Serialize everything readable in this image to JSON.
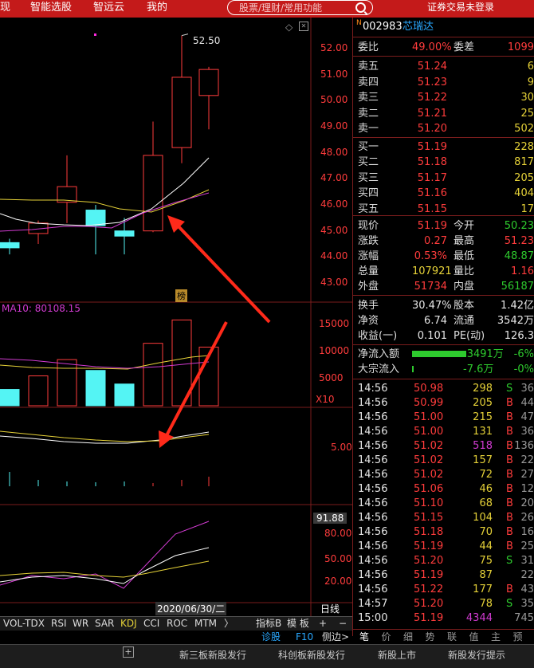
{
  "nav": {
    "items": [
      "现",
      "智能选股",
      "智远云",
      "我的"
    ]
  },
  "search": {
    "placeholder": "股票/理财/常用功能"
  },
  "status": "证券交易未登录",
  "stock": {
    "flag": "N",
    "code": "002983",
    "name": "芯瑞达"
  },
  "chart": {
    "high_mark": "52.50",
    "price_ticks": [
      "52.00",
      "51.00",
      "50.00",
      "49.00",
      "48.00",
      "47.00",
      "46.00",
      "45.00",
      "44.00",
      "43.00"
    ],
    "tag": "榜",
    "vol_label": "MA10: 80108.15",
    "vol_ticks": [
      "15000",
      "10000",
      "5000"
    ],
    "vol_unit": "X10",
    "macd_tick": "5.00",
    "kdj_top": "91.88",
    "kdj_ticks": [
      "80.00",
      "50.00",
      "20.00"
    ],
    "date": "2020/06/30/二",
    "period": "日线",
    "colors": {
      "up": "#ff3c3c",
      "down": "#54f4f4",
      "ma_white": "#ffffff",
      "ma_yellow": "#e6d238",
      "ma_magenta": "#d13bd1"
    }
  },
  "chart_data": {
    "type": "candlestick",
    "candles": [
      {
        "o": 44.55,
        "c": 44.35,
        "h": 44.7,
        "l": 44.1
      },
      {
        "o": 44.9,
        "c": 45.3,
        "h": 45.4,
        "l": 44.5
      },
      {
        "o": 46.1,
        "c": 46.7,
        "h": 47.9,
        "l": 45.3
      },
      {
        "o": 45.8,
        "c": 45.2,
        "h": 46.0,
        "l": 44.1
      },
      {
        "o": 45.0,
        "c": 44.8,
        "h": 45.5,
        "l": 44.1
      },
      {
        "o": 45.0,
        "c": 47.9,
        "h": 49.2,
        "l": 44.95
      },
      {
        "o": 48.2,
        "c": 50.9,
        "h": 52.5,
        "l": 47.6
      },
      {
        "o": 50.2,
        "c": 51.2,
        "h": 51.3,
        "l": 48.9
      }
    ],
    "volume": [
      {
        "v": 3000,
        "up": false
      },
      {
        "v": 5500,
        "up": true
      },
      {
        "v": 8500,
        "up": true
      },
      {
        "v": 6500,
        "up": false
      },
      {
        "v": 4000,
        "up": false
      },
      {
        "v": 11500,
        "up": true
      },
      {
        "v": 15800,
        "up": true
      },
      {
        "v": 10800,
        "up": true
      }
    ],
    "ylim": [
      43,
      52.8
    ]
  },
  "bottom_tabs": [
    "VOL-TDX",
    "RSI",
    "WR",
    "SAR",
    "KDJ",
    "CCI",
    "ROC",
    "MTM"
  ],
  "right_tabs": [
    "指标B",
    "模 板",
    "+",
    "−"
  ],
  "sub_links": [
    "诊股",
    "F10",
    "侧边>"
  ],
  "panel_tabs": [
    "笔",
    "价",
    "细",
    "势",
    "联",
    "值",
    "主",
    "预"
  ],
  "order_book": {
    "head": [
      {
        "label": "委比",
        "value": "49.00%"
      },
      {
        "label": "委差",
        "value": "1099"
      }
    ],
    "asks": [
      {
        "label": "卖五",
        "price": "51.24",
        "vol": "6"
      },
      {
        "label": "卖四",
        "price": "51.23",
        "vol": "9"
      },
      {
        "label": "卖三",
        "price": "51.22",
        "vol": "30"
      },
      {
        "label": "卖二",
        "price": "51.21",
        "vol": "25"
      },
      {
        "label": "卖一",
        "price": "51.20",
        "vol": "502"
      }
    ],
    "bids": [
      {
        "label": "买一",
        "price": "51.19",
        "vol": "228"
      },
      {
        "label": "买二",
        "price": "51.18",
        "vol": "817"
      },
      {
        "label": "买三",
        "price": "51.17",
        "vol": "205"
      },
      {
        "label": "买四",
        "price": "51.16",
        "vol": "404"
      },
      {
        "label": "买五",
        "price": "51.15",
        "vol": "17"
      }
    ]
  },
  "quote": [
    {
      "l1": "现价",
      "v1": "51.19",
      "c1": "red",
      "l2": "今开",
      "v2": "50.23",
      "c2": "grn"
    },
    {
      "l1": "涨跌",
      "v1": "0.27",
      "c1": "red",
      "l2": "最高",
      "v2": "51.23",
      "c2": "red"
    },
    {
      "l1": "涨幅",
      "v1": "0.53%",
      "c1": "red",
      "l2": "最低",
      "v2": "48.87",
      "c2": "grn"
    },
    {
      "l1": "总量",
      "v1": "107921",
      "c1": "yel",
      "l2": "量比",
      "v2": "1.16",
      "c2": "red"
    },
    {
      "l1": "外盘",
      "v1": "51734",
      "c1": "red",
      "l2": "内盘",
      "v2": "56187",
      "c2": "grn"
    }
  ],
  "fund": [
    {
      "l1": "换手",
      "v1": "30.47%",
      "l2": "股本",
      "v2": "1.42亿"
    },
    {
      "l1": "净资",
      "v1": "6.74",
      "l2": "流通",
      "v2": "3542万"
    },
    {
      "l1": "收益(一)",
      "v1": "0.101",
      "l2": "PE(动)",
      "v2": "126.3"
    }
  ],
  "flow": [
    {
      "label": "净流入额",
      "value": "-3491万",
      "pct": "-6%",
      "ratio": 0.85
    },
    {
      "label": "大宗流入",
      "value": "-7.6万",
      "pct": "-0%",
      "ratio": 0.02
    }
  ],
  "ticks": [
    {
      "t": "14:56",
      "p": "50.98",
      "v": "298",
      "s": "S",
      "n": "36",
      "vc": "yel",
      "sc": "grn"
    },
    {
      "t": "14:56",
      "p": "50.99",
      "v": "205",
      "s": "B",
      "n": "44",
      "vc": "yel",
      "sc": "red"
    },
    {
      "t": "14:56",
      "p": "51.00",
      "v": "215",
      "s": "B",
      "n": "47",
      "vc": "yel",
      "sc": "red"
    },
    {
      "t": "14:56",
      "p": "51.00",
      "v": "131",
      "s": "B",
      "n": "36",
      "vc": "yel",
      "sc": "red"
    },
    {
      "t": "14:56",
      "p": "51.02",
      "v": "518",
      "s": "B",
      "n": "136",
      "vc": "mag",
      "sc": "red"
    },
    {
      "t": "14:56",
      "p": "51.02",
      "v": "157",
      "s": "B",
      "n": "22",
      "vc": "yel",
      "sc": "red"
    },
    {
      "t": "14:56",
      "p": "51.02",
      "v": "72",
      "s": "B",
      "n": "27",
      "vc": "yel",
      "sc": "red"
    },
    {
      "t": "14:56",
      "p": "51.06",
      "v": "46",
      "s": "B",
      "n": "12",
      "vc": "yel",
      "sc": "red"
    },
    {
      "t": "14:56",
      "p": "51.10",
      "v": "68",
      "s": "B",
      "n": "20",
      "vc": "yel",
      "sc": "red"
    },
    {
      "t": "14:56",
      "p": "51.15",
      "v": "104",
      "s": "B",
      "n": "26",
      "vc": "yel",
      "sc": "red"
    },
    {
      "t": "14:56",
      "p": "51.18",
      "v": "70",
      "s": "B",
      "n": "16",
      "vc": "yel",
      "sc": "red"
    },
    {
      "t": "14:56",
      "p": "51.19",
      "v": "44",
      "s": "B",
      "n": "25",
      "vc": "yel",
      "sc": "red"
    },
    {
      "t": "14:56",
      "p": "51.20",
      "v": "75",
      "s": "S",
      "n": "31",
      "vc": "yel",
      "sc": "grn"
    },
    {
      "t": "14:56",
      "p": "51.19",
      "v": "87",
      "s": "",
      "n": "22",
      "vc": "yel",
      "sc": "red"
    },
    {
      "t": "14:56",
      "p": "51.22",
      "v": "177",
      "s": "B",
      "n": "43",
      "vc": "yel",
      "sc": "red"
    },
    {
      "t": "14:57",
      "p": "51.20",
      "v": "78",
      "s": "S",
      "n": "35",
      "vc": "yel",
      "sc": "grn"
    },
    {
      "t": "15:00",
      "p": "51.19",
      "v": "4344",
      "s": "",
      "n": "745",
      "vc": "mag",
      "sc": "red"
    }
  ],
  "bottom_bar": [
    "新三板新股发行",
    "科创板新股发行",
    "新股上市",
    "新股发行提示"
  ]
}
